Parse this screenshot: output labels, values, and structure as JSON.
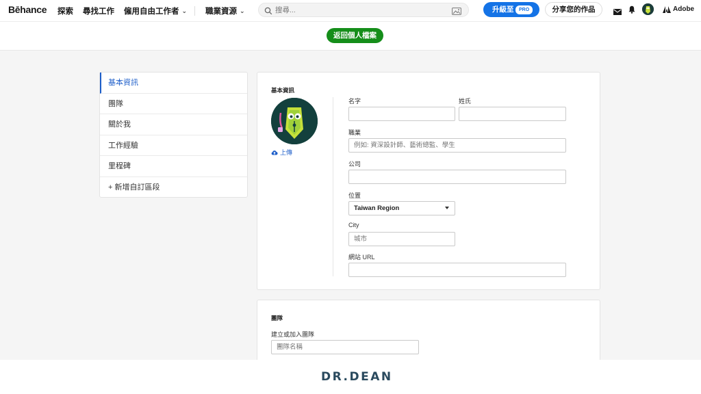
{
  "nav": {
    "logo": "Bēhance",
    "items": [
      "探索",
      "尋找工作",
      "僱用自由工作者",
      "職業資源"
    ],
    "search_placeholder": "搜尋...",
    "upgrade_label": "升級至",
    "pro_badge": "PRO",
    "share_label": "分享您的作品",
    "adobe_label": "Adobe"
  },
  "back_button": "返回個人檔案",
  "sidebar": {
    "items": [
      "基本資訊",
      "團隊",
      "關於我",
      "工作經驗",
      "里程碑",
      "+ 新增自訂區段"
    ],
    "active_index": 0
  },
  "basic_info": {
    "section_title": "基本資訊",
    "upload_label": "上傳",
    "first_name_label": "名字",
    "first_name_value": "",
    "last_name_label": "姓氏",
    "last_name_value": "",
    "occupation_label": "職業",
    "occupation_placeholder": "例如: 資深設計師、藝術總監、學生",
    "company_label": "公司",
    "company_value": "",
    "location_label": "位置",
    "location_value": "Taiwan Region",
    "city_label": "City",
    "city_placeholder": "城市",
    "website_label": "網站 URL",
    "website_value": ""
  },
  "team": {
    "section_title": "團隊",
    "create_label": "建立或加入團隊",
    "team_name_placeholder": "團隊名稱"
  },
  "footer": {
    "brand": "DR.DEAN"
  },
  "colors": {
    "primary_blue": "#1473e6",
    "back_green": "#158e1a",
    "active_link": "#1d5ec9"
  }
}
